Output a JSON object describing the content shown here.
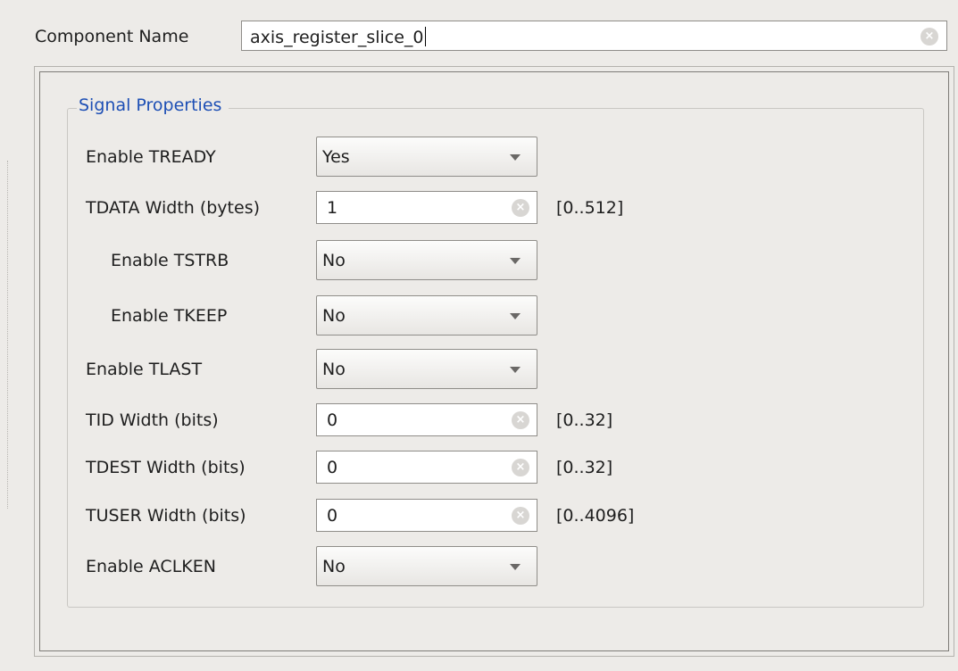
{
  "component_name": {
    "label": "Component Name",
    "value": "axis_register_slice_0",
    "clear_icon": "clear-icon"
  },
  "signal_properties": {
    "title": "Signal Properties",
    "enable_tready": {
      "label": "Enable TREADY",
      "value": "Yes"
    },
    "tdata_width": {
      "label": "TDATA Width (bytes)",
      "value": "1",
      "range": "[0..512]"
    },
    "enable_tstrb": {
      "label": "Enable TSTRB",
      "value": "No"
    },
    "enable_tkeep": {
      "label": "Enable TKEEP",
      "value": "No"
    },
    "enable_tlast": {
      "label": "Enable TLAST",
      "value": "No"
    },
    "tid_width": {
      "label": "TID Width (bits)",
      "value": "0",
      "range": "[0..32]"
    },
    "tdest_width": {
      "label": "TDEST Width (bits)",
      "value": "0",
      "range": "[0..32]"
    },
    "tuser_width": {
      "label": "TUSER Width (bits)",
      "value": "0",
      "range": "[0..4096]"
    },
    "enable_aclken": {
      "label": "Enable ACLKEN",
      "value": "No"
    }
  },
  "colors": {
    "background": "#edebe8",
    "group_title": "#1d4fb5",
    "border": "#8f8d89"
  }
}
